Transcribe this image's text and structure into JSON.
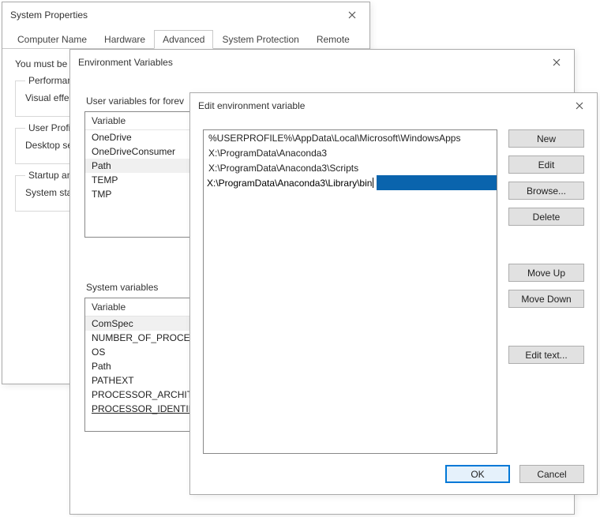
{
  "sysprops": {
    "title": "System Properties",
    "tabs": [
      "Computer Name",
      "Hardware",
      "Advanced",
      "System Protection",
      "Remote"
    ],
    "active_tab": 2,
    "intro": "You must be",
    "groups": {
      "perf": {
        "label": "Performance",
        "line": "Visual effec"
      },
      "profiles": {
        "label": "User Profile",
        "line": "Desktop se"
      },
      "startup": {
        "label": "Startup and",
        "line": "System star"
      }
    }
  },
  "envvars": {
    "title": "Environment Variables",
    "user_section": "User variables for forev",
    "sys_section": "System variables",
    "col_header": "Variable",
    "user_rows": [
      "OneDrive",
      "OneDriveConsumer",
      "Path",
      "TEMP",
      "TMP"
    ],
    "sys_rows": [
      "ComSpec",
      "NUMBER_OF_PROCES",
      "OS",
      "Path",
      "PATHEXT",
      "PROCESSOR_ARCHITE",
      "PROCESSOR_IDENTIFI"
    ],
    "ok": "OK",
    "cancel": "Cancel"
  },
  "editvar": {
    "title": "Edit environment variable",
    "paths": [
      "%USERPROFILE%\\AppData\\Local\\Microsoft\\WindowsApps",
      "X:\\ProgramData\\Anaconda3",
      "X:\\ProgramData\\Anaconda3\\Scripts",
      "X:\\ProgramData\\Anaconda3\\Library\\bin"
    ],
    "editing_index": 3,
    "buttons": {
      "new": "New",
      "edit": "Edit",
      "browse": "Browse...",
      "delete": "Delete",
      "moveup": "Move Up",
      "movedown": "Move Down",
      "edittext": "Edit text...",
      "ok": "OK",
      "cancel": "Cancel"
    }
  }
}
